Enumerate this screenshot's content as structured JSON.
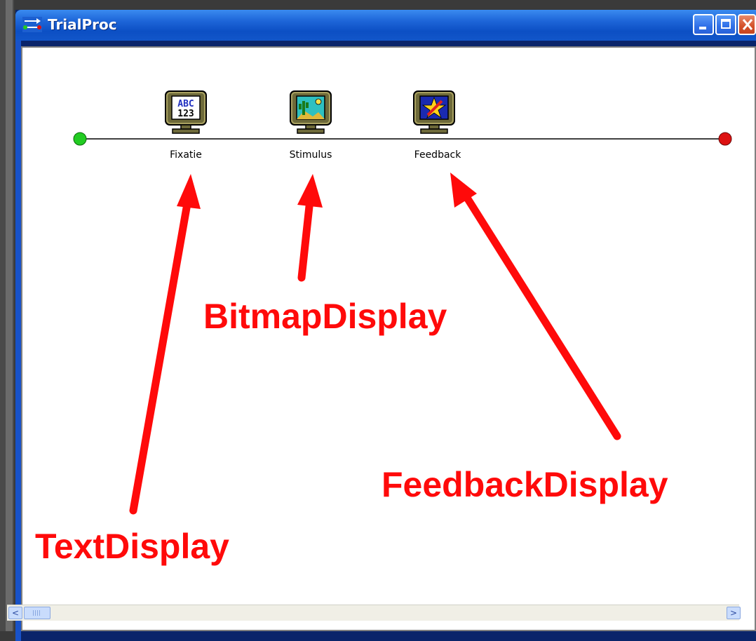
{
  "window": {
    "title": "TrialProc"
  },
  "timeline": {
    "items": [
      {
        "label": "Fixatie",
        "icon": "text-display-icon"
      },
      {
        "label": "Stimulus",
        "icon": "bitmap-display-icon"
      },
      {
        "label": "Feedback",
        "icon": "feedback-display-icon"
      }
    ]
  },
  "annotations": {
    "bitmap": "BitmapDisplay",
    "feedback": "FeedbackDisplay",
    "text": "TextDisplay"
  },
  "icon_glyphs": {
    "abc_top": "ABC",
    "abc_bottom": "123"
  },
  "colors": {
    "annotation": "#ff0a0a",
    "start_node": "#22cc22",
    "end_node": "#dd1111",
    "titlebar": "#1e66d9"
  },
  "scrollbar": {
    "left_arrow": "<",
    "right_arrow": ">"
  }
}
